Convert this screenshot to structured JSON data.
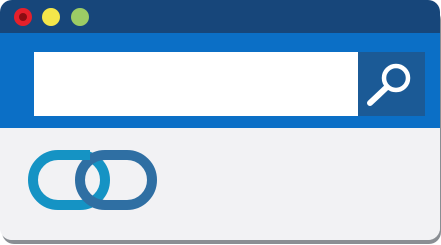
{
  "window": {
    "controls": [
      {
        "name": "close-dot",
        "color": "#e5202b"
      },
      {
        "name": "minimize-dot",
        "color": "#f4e64a"
      },
      {
        "name": "maximize-dot",
        "color": "#9ccc65"
      }
    ],
    "colors": {
      "titlebar": "#17467a",
      "toolbar": "#0b6fc6",
      "search_button": "#1b5a96",
      "content_background": "#f2f2f4"
    }
  },
  "search": {
    "value": "",
    "placeholder": "",
    "button_icon": "magnifying-glass-icon"
  },
  "content": {
    "icon": "link-chain-icon",
    "icon_colors": [
      "#1593c4",
      "#2f6fa3"
    ]
  }
}
